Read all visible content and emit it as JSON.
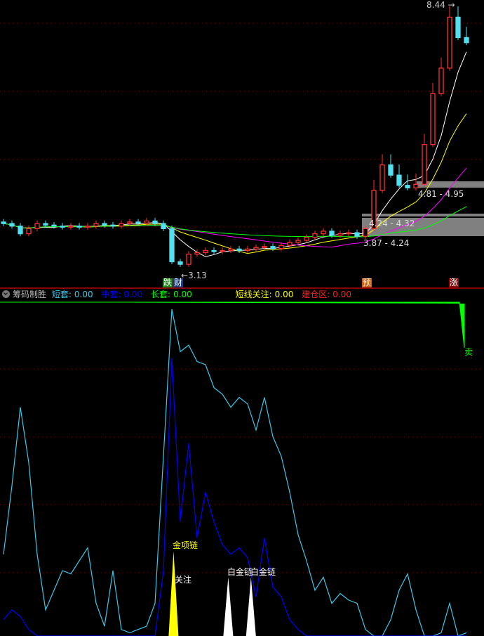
{
  "chart_data": [
    {
      "type": "candlestick",
      "title": "",
      "ylim": [
        3.0,
        8.5
      ],
      "close": [
        4.15,
        4.1,
        3.95,
        4.05,
        4.15,
        4.12,
        4.1,
        4.08,
        4.1,
        4.08,
        4.1,
        4.15,
        4.12,
        4.1,
        4.15,
        4.18,
        4.16,
        4.2,
        4.15,
        4.05,
        3.4,
        3.35,
        3.55,
        3.58,
        3.62,
        3.6,
        3.62,
        3.65,
        3.62,
        3.65,
        3.68,
        3.7,
        3.66,
        3.72,
        3.78,
        3.82,
        3.88,
        3.95,
        4.0,
        3.92,
        3.95,
        3.97,
        3.9,
        4.05,
        4.8,
        5.3,
        5.1,
        4.9,
        4.85,
        4.92,
        5.7,
        6.7,
        7.2,
        8.2,
        7.8,
        7.7
      ],
      "moving_averages": [
        {
          "name": "MA5",
          "period": 5,
          "color": "#ffffff"
        },
        {
          "name": "MA10",
          "period": 10,
          "color": "#ffff00"
        },
        {
          "name": "MA20",
          "period": 20,
          "color": "#ff00ff"
        },
        {
          "name": "MA60",
          "period": 40,
          "color": "#00ff00"
        }
      ],
      "annotations": {
        "high": "8.44",
        "low": "3.13"
      },
      "zones": [
        {
          "label": "4.81 - 4.95"
        },
        {
          "label": "4.24 - 4.32"
        },
        {
          "label": "3.87 - 4.24"
        }
      ],
      "signals": [
        {
          "text": "跌",
          "bar": 19,
          "bg": "#1a8a1a"
        },
        {
          "text": "财",
          "bar": 20.3,
          "bg": "#1b3a78"
        },
        {
          "text": "预",
          "bar": 42.6,
          "bg": "#d05a10"
        },
        {
          "text": "涨",
          "bar": 53,
          "bg": "#8a0a0a"
        }
      ]
    },
    {
      "type": "line",
      "title": "筹码制胜",
      "ylim": [
        0,
        100
      ],
      "series": [
        {
          "name": "短套",
          "color": "#3cc8e8",
          "values": [
            25,
            46,
            70,
            53,
            25,
            8,
            14,
            20,
            19,
            23,
            27,
            10,
            3,
            20,
            2,
            1,
            2,
            3,
            10,
            55,
            100,
            87,
            89,
            84,
            83,
            76,
            74,
            70,
            73,
            71,
            63,
            73,
            61,
            55,
            44,
            31,
            23,
            14,
            18,
            10,
            13,
            11,
            10,
            2,
            0,
            0,
            5,
            14,
            19,
            8,
            0,
            0,
            1,
            10,
            0,
            1
          ]
        },
        {
          "name": "中套",
          "color": "#0000ff",
          "values": [
            5,
            8,
            6,
            2,
            0,
            0,
            0,
            0,
            0,
            0,
            0,
            0,
            0,
            0,
            0,
            0,
            0,
            0,
            0,
            20,
            85,
            35,
            59,
            30,
            44,
            35,
            28,
            25,
            27,
            24,
            12,
            30,
            15,
            12,
            5,
            2,
            0,
            0,
            0,
            0,
            0,
            0,
            0,
            0,
            0,
            0,
            0,
            0,
            0,
            0,
            0,
            0,
            0,
            0,
            0,
            0
          ]
        }
      ],
      "legend": [
        {
          "label": "短套:",
          "value": "0.00",
          "color": "#3cc8e8"
        },
        {
          "label": "中套:",
          "value": "0.00",
          "color": "#0000ff"
        },
        {
          "label": "长套:",
          "value": "0.00",
          "color": "#00ff00"
        },
        {
          "label": "短线关注:",
          "value": "0.00",
          "color": "#ffff00"
        },
        {
          "label": "建仓区:",
          "value": "0.00",
          "color": "#ff2020"
        }
      ],
      "markers": [
        {
          "text": "金项链",
          "bar": 20.2,
          "height": 26,
          "color": "#ffff00"
        },
        {
          "text": "关注",
          "bar": 20.2,
          "color": "#ffffff"
        },
        {
          "text": "白金链",
          "bar": 26.7,
          "height": 18,
          "color": "#ffffff"
        },
        {
          "text": "白金链",
          "bar": 29.4,
          "height": 18,
          "color": "#ffffff"
        },
        {
          "text": "卖",
          "bar": 55,
          "color": "#00ff00"
        }
      ]
    }
  ]
}
